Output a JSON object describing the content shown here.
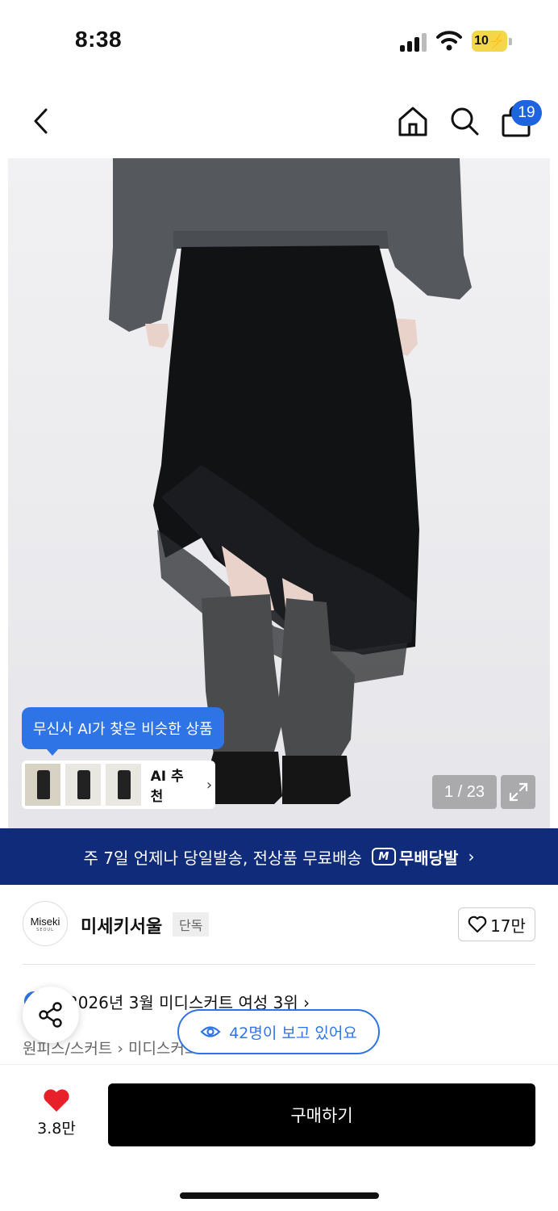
{
  "status_bar": {
    "time": "8:38",
    "battery": "10",
    "battery_color": "#f3d64a"
  },
  "nav": {
    "icons": [
      "chevron-left-icon",
      "home-icon",
      "search-icon",
      "shopping-bag-icon"
    ],
    "cart_count": "19",
    "badge_color": "#1e63e0"
  },
  "gallery": {
    "ai_tooltip": "무신사 AI가 찾은 비슷한 상품",
    "ai_label": "AI 추천",
    "page_counter": "1 / 23",
    "accent_color": "#2f74e6"
  },
  "delivery_banner": {
    "text": "주 7일 언제나 당일발송, 전상품 무료배송",
    "badge_text": "무배당발",
    "badge_icon_text": "M",
    "background": "#0f2b7a"
  },
  "brand": {
    "logo_name": "Miseki",
    "logo_sub": "SEOUL",
    "name": "미세키서울",
    "tag": "단독",
    "likes": "17만"
  },
  "product": {
    "ranking": "2026년 3월 미디스커트 여성 3위 ›",
    "breadcrumb": "원피스/스커트 › 미디스커트",
    "viewers": "42명이 보고 있어요"
  },
  "bottom_bar": {
    "wish_count": "3.8만",
    "buy_label": "구매하기",
    "heart_color": "#e8202a"
  }
}
